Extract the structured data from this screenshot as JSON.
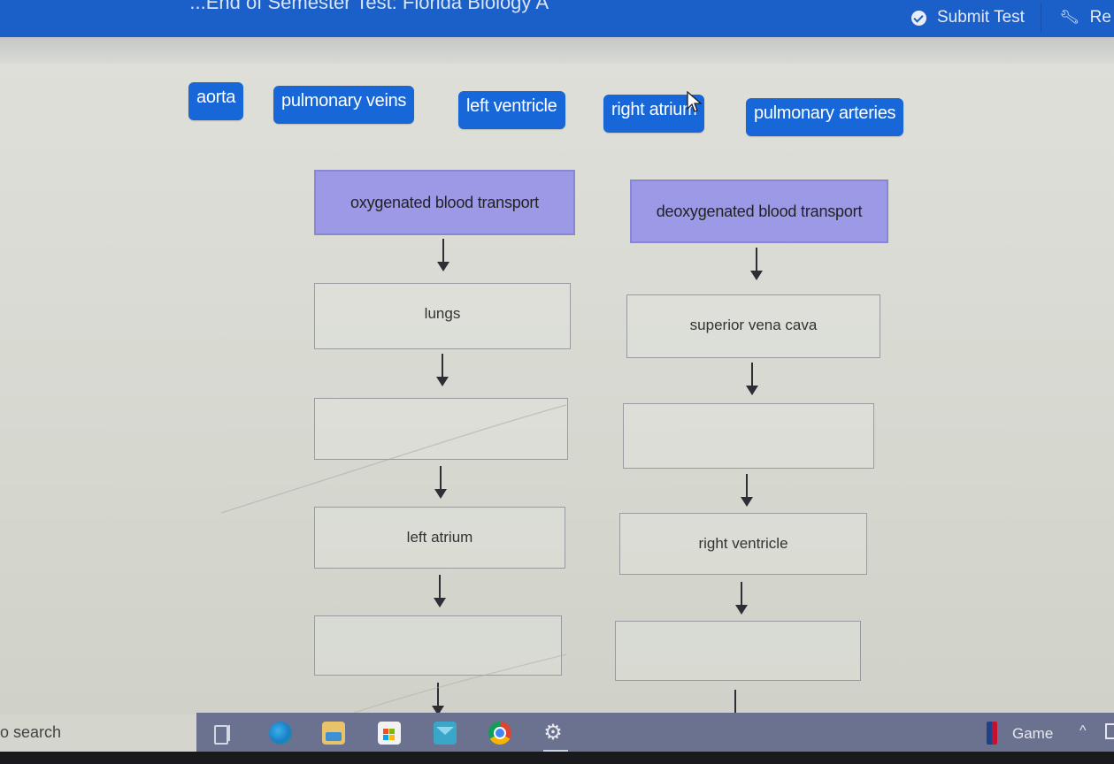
{
  "header": {
    "title": "...End of Semester Test: Florida Biology A",
    "submit_label": "Submit Test",
    "tools_label": "Re",
    "submit_icon": "check-circle-icon",
    "tools_icon": "wrench-icon",
    "bar_color": "#1b5fc8"
  },
  "answer_bank": {
    "chip_color": "#1767d8",
    "chips": [
      {
        "label": "aorta"
      },
      {
        "label": "pulmonary veins"
      },
      {
        "label": "left ventricle"
      },
      {
        "label": "right atrium"
      },
      {
        "label": "pulmonary arteries"
      }
    ]
  },
  "flow": {
    "header_color": "#9c9ae6",
    "left": {
      "header": "oxygenated blood transport",
      "steps": [
        "lungs",
        "",
        "left atrium",
        ""
      ]
    },
    "right": {
      "header": "deoxygenated blood transport",
      "steps": [
        "superior vena cava",
        "",
        "right ventricle",
        ""
      ]
    }
  },
  "taskbar": {
    "search_text": "o search",
    "apps": [
      "task-view-icon",
      "edge-icon",
      "file-explorer-icon",
      "store-icon",
      "mail-icon",
      "chrome-icon",
      "settings-icon"
    ],
    "tray_label": "Game",
    "tray_chevron": "^"
  }
}
